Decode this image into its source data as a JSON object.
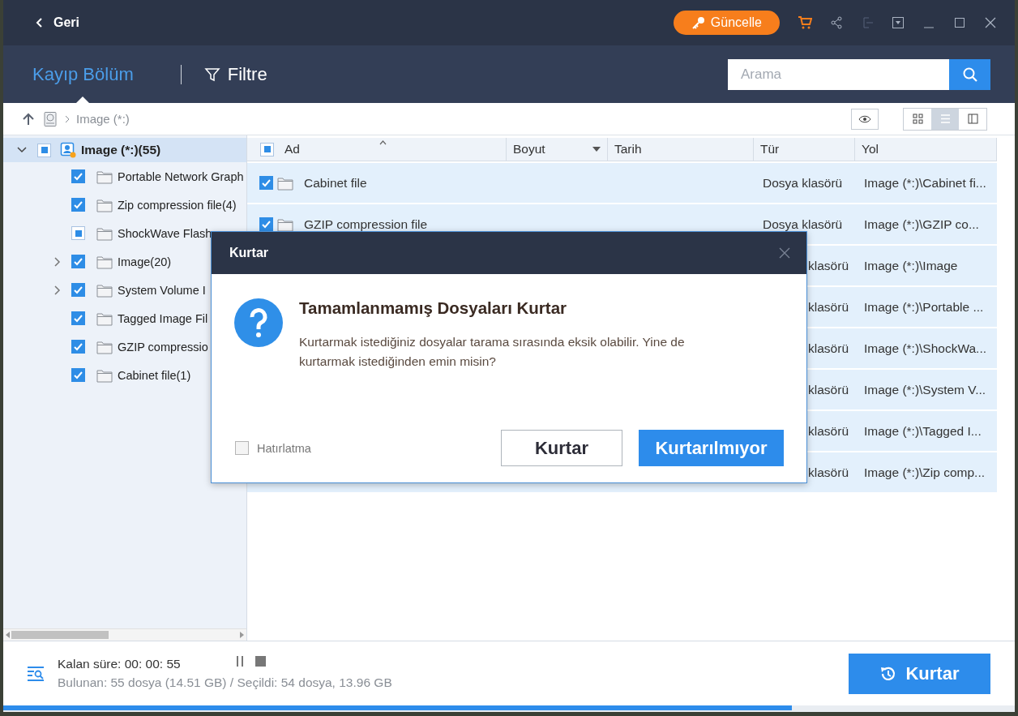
{
  "title_bar": {
    "back": "Geri",
    "update_button": "Güncelle"
  },
  "header": {
    "tabs": [
      {
        "label": "Kayıp Bölüm",
        "kind": "plain",
        "selected": true
      },
      {
        "label": "Filtre",
        "kind": "filter",
        "selected": false
      }
    ],
    "search": {
      "placeholder": "Arama"
    }
  },
  "breadcrumb": {
    "path": "Image (*:)"
  },
  "view_modes": [
    {
      "kind": "grid",
      "selected": false
    },
    {
      "kind": "list",
      "selected": true
    },
    {
      "kind": "detail",
      "selected": false
    }
  ],
  "tree": {
    "label": "Image (*:)(55)",
    "checked": false,
    "indeterminate": true,
    "expanded": true,
    "selected": true,
    "children": [
      {
        "label": "Portable Network Graph",
        "checked": true,
        "indeterminate": false,
        "expandable": false
      },
      {
        "label": "Zip compression file(4)",
        "checked": true,
        "indeterminate": false,
        "expandable": false
      },
      {
        "label": "ShockWave Flash",
        "checked": false,
        "indeterminate": true,
        "expandable": false
      },
      {
        "label": "Image(20)",
        "checked": true,
        "indeterminate": false,
        "expandable": true
      },
      {
        "label": "System Volume I",
        "checked": true,
        "indeterminate": false,
        "expandable": true
      },
      {
        "label": "Tagged Image Fil",
        "checked": true,
        "indeterminate": false,
        "expandable": false
      },
      {
        "label": "GZIP compressio",
        "checked": true,
        "indeterminate": false,
        "expandable": false
      },
      {
        "label": "Cabinet file(1)",
        "checked": true,
        "indeterminate": false,
        "expandable": false
      }
    ]
  },
  "table": {
    "header_checked": false,
    "header_indeterminate": true,
    "columns": [
      {
        "label": "Ad",
        "sorted_ascending": true
      },
      {
        "label": "Boyut",
        "menu": true
      },
      {
        "label": "Tarih"
      },
      {
        "label": "Tür"
      },
      {
        "label": "Yol"
      }
    ],
    "rows": [
      {
        "checked": true,
        "name": "Cabinet file",
        "type": "Dosya klasörü",
        "path": "Image (*:)\\Cabinet fi..."
      },
      {
        "checked": true,
        "name": "GZIP compression file",
        "type": "Dosya klasörü",
        "path": "Image (*:)\\GZIP co..."
      },
      {
        "type": "klasörü",
        "path": "Image (*:)\\Image"
      },
      {
        "type": "klasörü",
        "path": "Image (*:)\\Portable ..."
      },
      {
        "type": "klasörü",
        "path": "Image (*:)\\ShockWa..."
      },
      {
        "type": "klasörü",
        "path": "Image (*:)\\System V..."
      },
      {
        "type": "klasörü",
        "path": "Image (*:)\\Tagged I..."
      },
      {
        "type": "klasörü",
        "path": "Image (*:)\\Zip comp..."
      }
    ]
  },
  "footer": {
    "remaining": "Kalan süre: 00: 00: 55",
    "summary": "Bulunan: 55 dosya (14.51 GB) / Seçildi: 54 dosya, 13.96 GB",
    "recover_button": "Kurtar",
    "progress": {
      "level": 0.78
    }
  },
  "dialog": {
    "title": "Kurtar",
    "heading": "Tamamlanmamış Dosyaları Kurtar",
    "message": "Kurtarmak istediğiniz dosyalar tarama sırasında eksik olabilir. Yine de kurtarmak istediğinden emin misin?",
    "dont_remind": {
      "label": "Hatırlatma",
      "checked": false
    },
    "buttons": [
      {
        "label": "Kurtar",
        "kind": "secondary"
      },
      {
        "label": "Kurtarılmıyor",
        "kind": "primary"
      }
    ]
  }
}
